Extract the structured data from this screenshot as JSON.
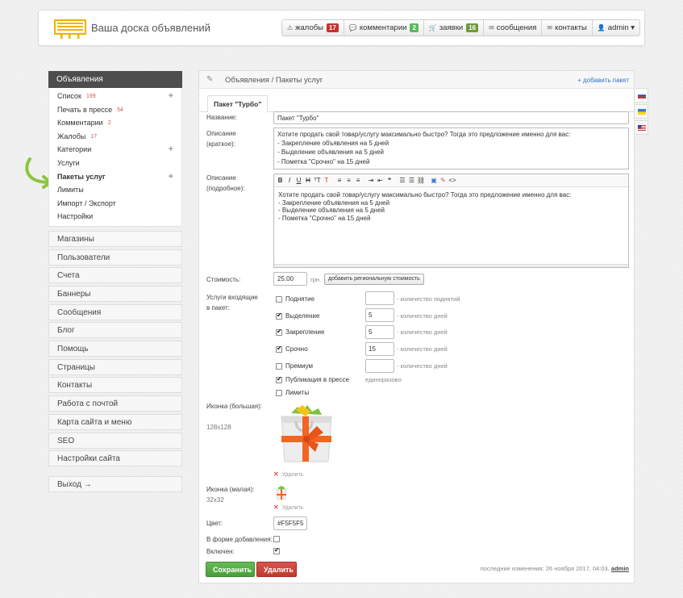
{
  "site": {
    "title": "Ваша доска объявлений"
  },
  "topnav": [
    {
      "icon": "⚠",
      "label": "жалобы",
      "count": "17",
      "color": "red"
    },
    {
      "icon": "💬",
      "label": "комментарии",
      "count": "2",
      "color": "green"
    },
    {
      "icon": "🛒",
      "label": "заявки",
      "count": "16",
      "color": "olive"
    },
    {
      "icon": "✉",
      "label": "сообщения",
      "count": "",
      "color": ""
    },
    {
      "icon": "✉",
      "label": "контакты",
      "count": "",
      "color": ""
    },
    {
      "icon": "👤",
      "label": "admin ▾",
      "count": "",
      "color": ""
    }
  ],
  "sidebar": {
    "head": "Объявления",
    "items": [
      {
        "label": "Список",
        "badge": "199",
        "plus": true,
        "active": false
      },
      {
        "label": "Печать в прессе",
        "badge": "54",
        "plus": false,
        "active": false
      },
      {
        "label": "Комментарии",
        "badge": "2",
        "plus": false,
        "active": false
      },
      {
        "label": "Жалобы",
        "badge": "17",
        "plus": false,
        "active": false
      },
      {
        "label": "Категории",
        "badge": "",
        "plus": true,
        "active": false
      },
      {
        "label": "Услуги",
        "badge": "",
        "plus": false,
        "active": false
      },
      {
        "label": "Пакеты услуг",
        "badge": "",
        "plus": true,
        "active": true
      },
      {
        "label": "Лимиты",
        "badge": "",
        "plus": false,
        "active": false
      },
      {
        "label": "Импорт / Экспорт",
        "badge": "",
        "plus": false,
        "active": false
      },
      {
        "label": "Настройки",
        "badge": "",
        "plus": false,
        "active": false
      }
    ],
    "sections": [
      "Магазины",
      "Пользователи",
      "Счета",
      "Баннеры",
      "Сообщения",
      "Блог",
      "Помощь",
      "Страницы",
      "Контакты",
      "Работа с почтой",
      "Карта сайта и меню",
      "SEO",
      "Настройки сайта"
    ],
    "exit": "Выход →"
  },
  "main": {
    "breadcrumb": "Объявления / Пакеты услуг",
    "add_link": "+ добавить пакет",
    "tab": "Пакет \"Турбо\"",
    "labels": {
      "name": "Название:",
      "short_desc_1": "Описание",
      "short_desc_2": "(краткое):",
      "full_desc_1": "Описание",
      "full_desc_2": "(подробное):",
      "price": "Стоимость:",
      "services_1": "Услуги входящие",
      "services_2": "в пакет:",
      "icon_big": "Иконка (большая):",
      "icon_big_size": "128x128",
      "icon_small": "Иконка (малая):",
      "icon_small_size": "32x32",
      "color": "Цвет:",
      "in_form": "В форме добавления:",
      "enabled": "Включен:"
    },
    "name_value": "Пакет \"Турбо\"",
    "short_desc": [
      "Хотите продать свой товар/услугу максимально быстро? Тогда это предложение именно для вас:",
      "- Закрепление объявления на 5 дней",
      "- Выделение объявления на 5 дней",
      "- Пометка \"Срочно\" на 15 дней"
    ],
    "full_desc": [
      "Хотите продать свой товар/услугу максимально быстро? Тогда это предложение именно для вас:",
      "- Закрепление объявления на 5 дней",
      "- Выделение объявления на 5 дней",
      "- Пометка \"Срочно\" на 15 дней"
    ],
    "price_value": "25.00",
    "currency": "грн.",
    "regional_btn": "добавить региональную стоимость",
    "services": [
      {
        "label": "Поднятие",
        "checked": false,
        "value": "",
        "hint": "- количество поднятий"
      },
      {
        "label": "Выделение",
        "checked": true,
        "value": "5",
        "hint": "- количество дней"
      },
      {
        "label": "Закрепление",
        "checked": true,
        "value": "5",
        "hint": "- количество дней"
      },
      {
        "label": "Срочно",
        "checked": true,
        "value": "15",
        "hint": "- количество дней"
      },
      {
        "label": "Премиум",
        "checked": false,
        "value": "",
        "hint": "- количество дней"
      }
    ],
    "press": {
      "label": "Публикация в прессе",
      "checked": true,
      "hint": "единоразово"
    },
    "limits": {
      "label": "Лимиты",
      "checked": false
    },
    "delete_label": "Удалить",
    "color_value": "#F5F5F5",
    "in_form_checked": false,
    "enabled_checked": true,
    "save_btn": "Сохранить",
    "delete_btn": "Удалить",
    "changes": "последние изменения: 26 ноября 2017, 04:03,",
    "changes_user": "admin"
  },
  "languages": [
    "ru-flag-icon",
    "ua-flag-icon",
    "us-flag-icon"
  ]
}
